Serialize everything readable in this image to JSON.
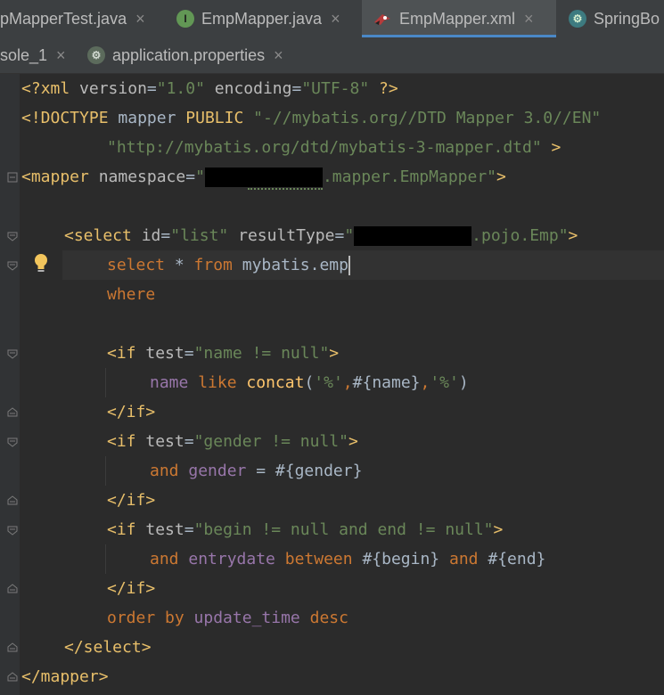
{
  "tabs_top": [
    {
      "label": "pMapperTest.java",
      "active": false
    },
    {
      "label": "EmpMapper.java",
      "icon": "interface-icon",
      "active": false
    },
    {
      "label": "EmpMapper.xml",
      "icon": "xml-file-icon",
      "active": true
    },
    {
      "label": "SpringBo",
      "icon": "spring-boot-icon",
      "active": false
    }
  ],
  "tabs_bottom": [
    {
      "label": "sole_1",
      "active": false
    },
    {
      "label": "application.properties",
      "icon": "properties-file-icon",
      "active": false
    }
  ],
  "tab_close_glyph": "×",
  "icon_glyphs": {
    "interface": "I",
    "spring": "⚙",
    "props": "⚙"
  },
  "code": {
    "xml_decl": {
      "open": "<?",
      "name": "xml",
      "version_attr": "version",
      "eq": "=",
      "version_val": "\"1.0\"",
      "encoding_attr": "encoding",
      "encoding_val": "\"UTF-8\"",
      "close": "?>"
    },
    "doctype": {
      "open": "<!DOCTYPE",
      "name": "mapper",
      "public": "PUBLIC",
      "public_id": "\"-//mybatis.org//DTD Mapper 3.0//EN\""
    },
    "doctype_dtd": "\"http://mybatis.org/dtd/mybatis-3-mapper.dtd\"",
    "doctype_close": ">",
    "mapper_open": {
      "tag": "<mapper",
      "attr": "namespace",
      "eq": "=",
      "q": "\"",
      "suffix": ".mapper.EmpMapper\"",
      "close": ">"
    },
    "select_open": {
      "tag": "<select",
      "id_attr": "id",
      "id_val": "\"list\"",
      "rt_attr": "resultType",
      "q": "\"",
      "rt_suffix": ".pojo.Emp\"",
      "close": ">"
    },
    "sql1": {
      "kw1": "select",
      "star": " * ",
      "kw2": "from",
      "table": " mybatis.emp"
    },
    "sql_where": "where",
    "if1": {
      "tag": "<if",
      "attr": "test",
      "eq": "=",
      "val": "\"name != null\"",
      "close": ">"
    },
    "if1_body": {
      "f1": "name",
      "kw": "like",
      "fn": "concat",
      "p1": "(",
      "s1": "'%'",
      "c1": ",",
      "param": "#{name}",
      "c2": ",",
      "s2": "'%'",
      "p2": ")"
    },
    "if_close": "</if>",
    "if2": {
      "tag": "<if",
      "attr": "test",
      "eq": "=",
      "val": "\"gender != null\"",
      "close": ">"
    },
    "if2_body": {
      "kw": "and",
      "f1": "gender",
      "op": " = ",
      "param": "#{gender}"
    },
    "if3": {
      "tag": "<if",
      "attr": "test",
      "eq": "=",
      "val": "\"begin != null and end != null\"",
      "close": ">"
    },
    "if3_body": {
      "kw1": "and",
      "f1": "entrydate",
      "kw2": "between",
      "p1": "#{begin}",
      "kw3": "and",
      "p2": "#{end}"
    },
    "order": {
      "kw": "order by",
      "f1": "update_time",
      "kw2": "desc"
    },
    "select_close": "</select>",
    "mapper_close": "</mapper>"
  },
  "colors": {
    "tag": "#e8bf6a",
    "string": "#6a8759",
    "keyword": "#cc7832",
    "field": "#9876aa",
    "function": "#ffc66d",
    "text": "#a9b7c6",
    "accent": "#4a88c7"
  }
}
